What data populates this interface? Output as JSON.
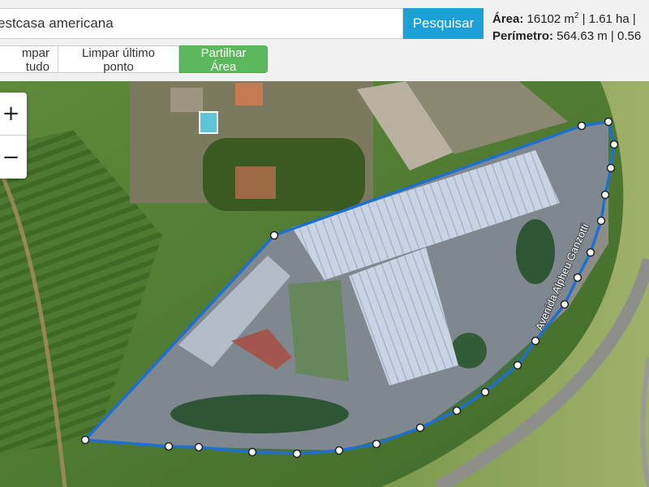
{
  "search": {
    "value": "estcasa americana",
    "button_label": "Pesquisar"
  },
  "stats": {
    "area_label": "Área:",
    "area_value": "16102 m",
    "area_sup": "2",
    "area_rest": " | 1.61 ha |",
    "perimeter_label": "Perímetro:",
    "perimeter_value": " 564.63 m | 0.56"
  },
  "toolbar": {
    "clear_all_label": "mpar tudo",
    "clear_last_label": "Limpar último ponto",
    "share_label": "Partilhar Área"
  },
  "zoom": {
    "in_label": "+",
    "out_label": "−"
  },
  "map": {
    "street_label": "Avenida Alpheu Ganzotti",
    "polygon_color": "#1f6fd1",
    "vertex_fill": "#ffffff",
    "vertex_stroke": "#222222"
  }
}
